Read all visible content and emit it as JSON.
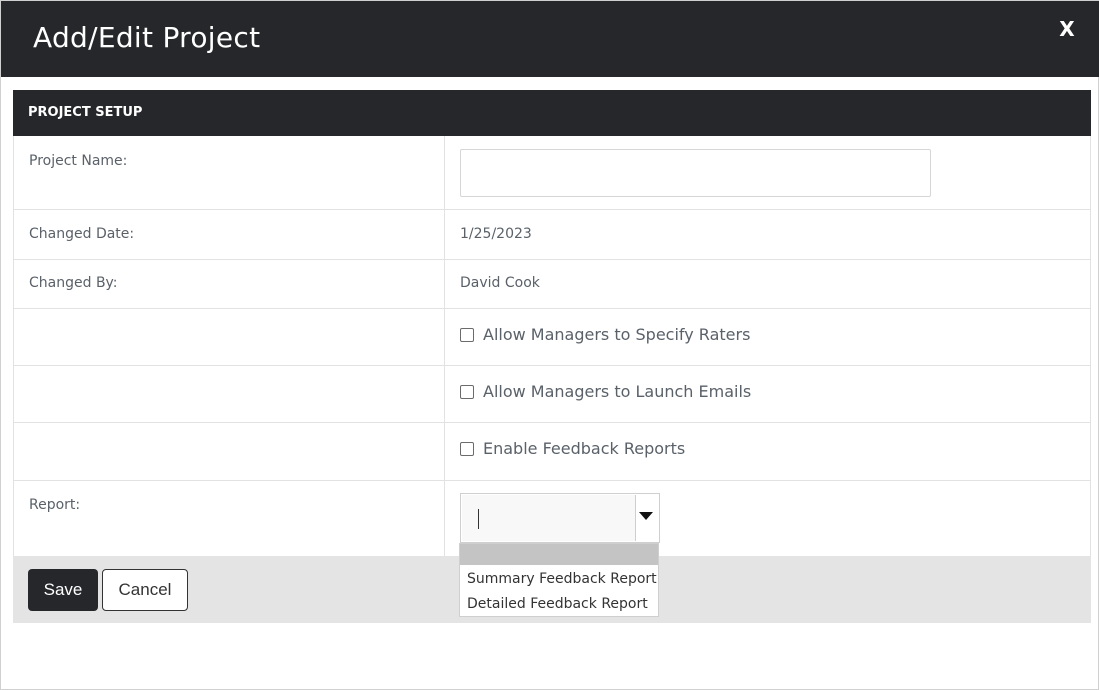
{
  "dialog": {
    "title": "Add/Edit Project",
    "close_label": "X"
  },
  "section": {
    "header": "PROJECT SETUP"
  },
  "fields": {
    "project_name_label": "Project Name:",
    "project_name_value": "",
    "changed_date_label": "Changed Date:",
    "changed_date_value": "1/25/2023",
    "changed_by_label": "Changed By:",
    "changed_by_value": "David Cook",
    "report_label": "Report:",
    "report_value": ""
  },
  "options": [
    {
      "label": "Allow Managers to Specify Raters",
      "checked": false
    },
    {
      "label": "Allow Managers to Launch Emails",
      "checked": false
    },
    {
      "label": "Enable Feedback Reports",
      "checked": false
    }
  ],
  "report_dropdown": {
    "items": [
      "",
      "Summary Feedback Report",
      "Detailed Feedback Report"
    ]
  },
  "buttons": {
    "save": "Save",
    "cancel": "Cancel"
  },
  "colors": {
    "header_bg": "#25272b",
    "footer_bg": "#e4e4e4",
    "text": "#5a6169"
  }
}
